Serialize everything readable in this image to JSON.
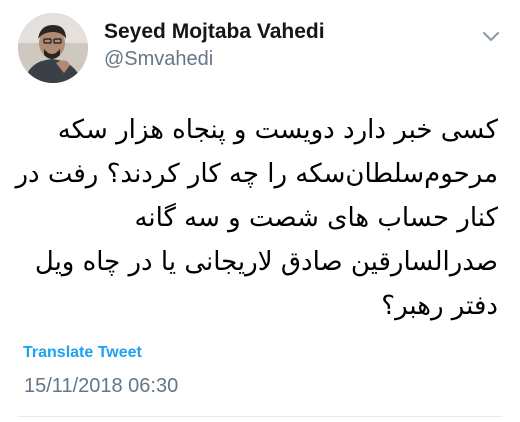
{
  "author": {
    "display_name": "Seyed Mojtaba Vahedi",
    "handle": "@Smvahedi",
    "avatar_icon": "profile-photo"
  },
  "menu": {
    "icon": "chevron-down-icon"
  },
  "tweet": {
    "lines": [
      "کسی خبر دارد دویست و پنجاه هزار سکه",
      "مرحوم‌سلطان‌سکه را چه کار کردند؟ رفت در",
      "کنار حساب های شصت و سه گانه",
      "صدرالسارقین صادق لاریجانی یا در چاه ویل",
      "دفتر رهبر؟"
    ]
  },
  "translate_label": "Translate Tweet",
  "timestamp": "15/11/2018 06:30",
  "colors": {
    "link": "#1da1f2",
    "secondary_text": "#657786",
    "divider": "#e6ecf0"
  }
}
